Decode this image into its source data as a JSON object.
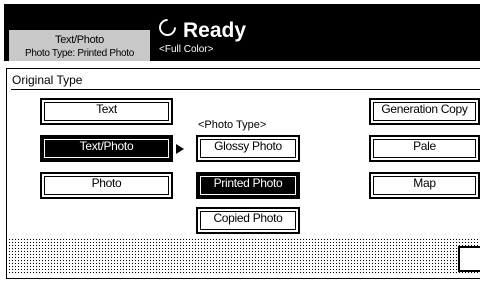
{
  "status": {
    "mode_line1": "Text/Photo",
    "mode_line2": "Photo Type: Printed Photo",
    "ready": "Ready",
    "color": "<Full Color>"
  },
  "panel": {
    "title": "Original Type",
    "photo_type_label": "<Photo Type>"
  },
  "left_buttons": [
    {
      "label": "Text",
      "selected": false
    },
    {
      "label": "Text/Photo",
      "selected": true
    },
    {
      "label": "Photo",
      "selected": false
    }
  ],
  "photo_type_buttons": [
    {
      "label": "Glossy Photo",
      "selected": false
    },
    {
      "label": "Printed Photo",
      "selected": true
    },
    {
      "label": "Copied Photo",
      "selected": false
    }
  ],
  "right_buttons": [
    {
      "label": "Generation Copy",
      "selected": false
    },
    {
      "label": "Pale",
      "selected": false
    },
    {
      "label": "Map",
      "selected": false
    }
  ],
  "colors": {
    "selected_bg": "#000000",
    "tab_bg": "#c8c8c8"
  }
}
